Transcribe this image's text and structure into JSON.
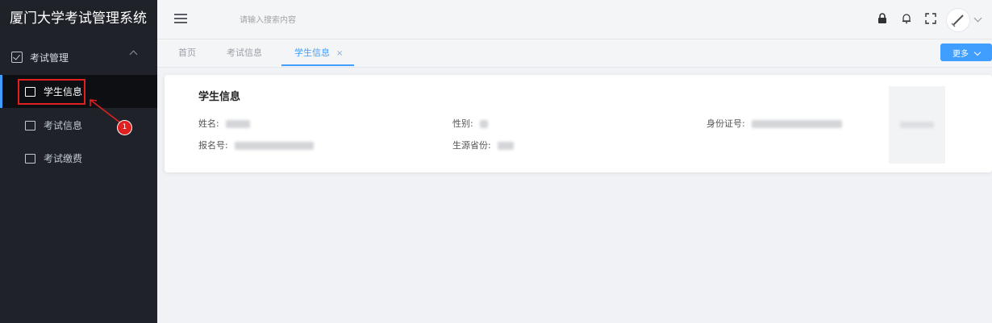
{
  "app": {
    "title": "厦门大学考试管理系统"
  },
  "sidebar": {
    "group": {
      "label": "考试管理",
      "icon": "checkbox-icon"
    },
    "items": [
      {
        "label": "学生信息",
        "icon": "image-icon",
        "active": true
      },
      {
        "label": "考试信息",
        "icon": "list-icon",
        "active": false
      },
      {
        "label": "考试缴费",
        "icon": "document-icon",
        "active": false
      }
    ]
  },
  "annotation": {
    "badge": "1",
    "color": "#e02020"
  },
  "header": {
    "search_placeholder": "请输入搜索内容",
    "icons": [
      "lock-icon",
      "bell-icon",
      "fullscreen-icon",
      "avatar"
    ]
  },
  "tabs": [
    {
      "label": "首页"
    },
    {
      "label": "考试信息"
    },
    {
      "label": "学生信息",
      "active": true,
      "close": "×"
    }
  ],
  "toolbar": {
    "more_label": "更多"
  },
  "student_card": {
    "title": "学生信息",
    "fields": {
      "name_label": "姓名:",
      "gender_label": "性别:",
      "id_label": "身份证号:",
      "reg_label": "报名号:",
      "province_label": "生源省份:"
    }
  },
  "colors": {
    "accent": "#409eff",
    "sidebar_bg": "#1f2329",
    "annotation": "#e02020"
  }
}
